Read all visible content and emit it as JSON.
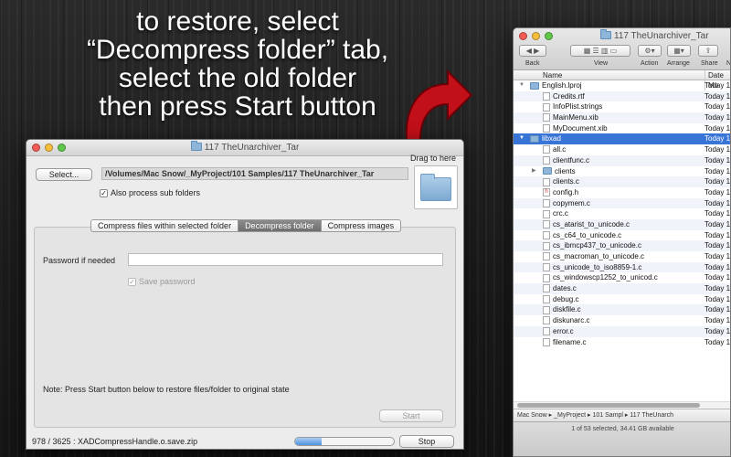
{
  "headline": [
    "to restore, select",
    "“Decompress folder” tab,",
    "select the old folder",
    "then press Start button"
  ],
  "app": {
    "title": "117 TheUnarchiver_Tar",
    "select_label": "Select...",
    "path": "/Volumes/Mac Snow/_MyProject/101 Samples/117 TheUnarchiver_Tar",
    "drag_label": "Drag to here",
    "subfolders_label": "Also process sub folders",
    "tabs": [
      "Compress files within selected folder",
      "Decompress folder",
      "Compress images"
    ],
    "selected_tab": "Decompress folder",
    "password_label": "Password if needed",
    "password_value": "",
    "save_password_label": "Save password",
    "note": "Note: Press Start button below to restore files/folder to original state",
    "start_label": "Start",
    "status": "978 / 3625 : XADCompressHandle.o.save.zip",
    "progress": 0.27,
    "stop_label": "Stop"
  },
  "finder": {
    "title": "117 TheUnarchiver_Tar",
    "toolbar": {
      "back": "Back",
      "view": "View",
      "action": "Action",
      "arrange": "Arrange",
      "share": "Share",
      "more": "N"
    },
    "columns": {
      "name": "Name",
      "date": "Date Mo"
    },
    "rows": [
      {
        "name": "English.lproj",
        "date": "Today 1",
        "indent": 0,
        "kind": "folder",
        "tri": "▼"
      },
      {
        "name": "Credits.rtf",
        "date": "Today 1",
        "indent": 1,
        "kind": "file",
        "tri": ""
      },
      {
        "name": "InfoPlist.strings",
        "date": "Today 1",
        "indent": 1,
        "kind": "file",
        "tri": ""
      },
      {
        "name": "MainMenu.xib",
        "date": "Today 1",
        "indent": 1,
        "kind": "file",
        "tri": ""
      },
      {
        "name": "MyDocument.xib",
        "date": "Today 1",
        "indent": 1,
        "kind": "file",
        "tri": ""
      },
      {
        "name": "libxad",
        "date": "Today 1",
        "indent": 0,
        "kind": "folder",
        "tri": "▼",
        "selected": true
      },
      {
        "name": "all.c",
        "date": "Today 1",
        "indent": 1,
        "kind": "file",
        "tri": ""
      },
      {
        "name": "clientfunc.c",
        "date": "Today 1",
        "indent": 1,
        "kind": "file",
        "tri": ""
      },
      {
        "name": "clients",
        "date": "Today 1",
        "indent": 1,
        "kind": "folder",
        "tri": "▶"
      },
      {
        "name": "clients.c",
        "date": "Today 1",
        "indent": 1,
        "kind": "file",
        "tri": ""
      },
      {
        "name": "config.h",
        "date": "Today 1",
        "indent": 1,
        "kind": "h",
        "tri": ""
      },
      {
        "name": "copymem.c",
        "date": "Today 1",
        "indent": 1,
        "kind": "file",
        "tri": ""
      },
      {
        "name": "crc.c",
        "date": "Today 1",
        "indent": 1,
        "kind": "file",
        "tri": ""
      },
      {
        "name": "cs_atarist_to_unicode.c",
        "date": "Today 1",
        "indent": 1,
        "kind": "file",
        "tri": ""
      },
      {
        "name": "cs_c64_to_unicode.c",
        "date": "Today 1",
        "indent": 1,
        "kind": "file",
        "tri": ""
      },
      {
        "name": "cs_ibmcp437_to_unicode.c",
        "date": "Today 1",
        "indent": 1,
        "kind": "file",
        "tri": ""
      },
      {
        "name": "cs_macroman_to_unicode.c",
        "date": "Today 1",
        "indent": 1,
        "kind": "file",
        "tri": ""
      },
      {
        "name": "cs_unicode_to_iso8859-1.c",
        "date": "Today 1",
        "indent": 1,
        "kind": "file",
        "tri": ""
      },
      {
        "name": "cs_windowscp1252_to_unicod.c",
        "date": "Today 1",
        "indent": 1,
        "kind": "file",
        "tri": ""
      },
      {
        "name": "dates.c",
        "date": "Today 1",
        "indent": 1,
        "kind": "file",
        "tri": ""
      },
      {
        "name": "debug.c",
        "date": "Today 1",
        "indent": 1,
        "kind": "file",
        "tri": ""
      },
      {
        "name": "diskfile.c",
        "date": "Today 1",
        "indent": 1,
        "kind": "file",
        "tri": ""
      },
      {
        "name": "diskunarc.c",
        "date": "Today 1",
        "indent": 1,
        "kind": "file",
        "tri": ""
      },
      {
        "name": "error.c",
        "date": "Today 1",
        "indent": 1,
        "kind": "file",
        "tri": ""
      },
      {
        "name": "filename.c",
        "date": "Today 1",
        "indent": 1,
        "kind": "file",
        "tri": ""
      }
    ],
    "path": [
      "Mac Snow",
      "_MyProject",
      "101 Sampl",
      "117 TheUnarch"
    ],
    "status": "1 of 53 selected, 34.41 GB available"
  }
}
